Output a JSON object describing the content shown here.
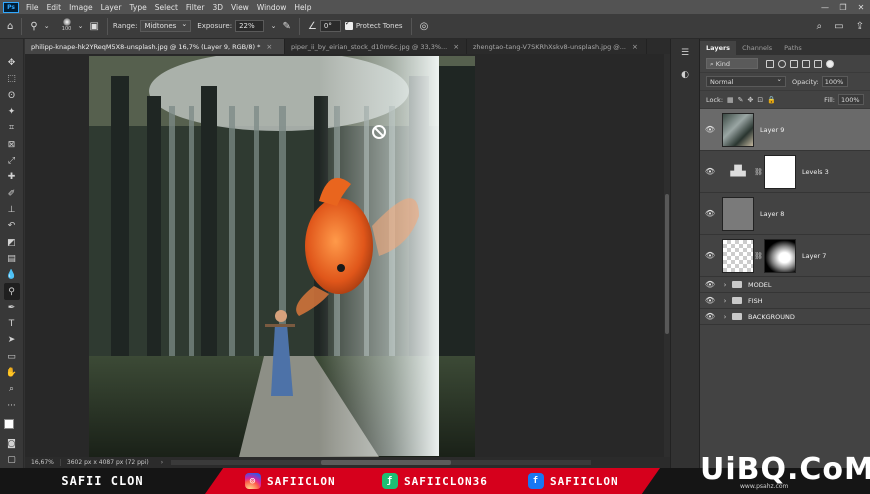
{
  "menubar": {
    "logo": "Ps",
    "items": [
      "File",
      "Edit",
      "Image",
      "Layer",
      "Type",
      "Select",
      "Filter",
      "3D",
      "View",
      "Window",
      "Help"
    ],
    "controls": [
      "—",
      "❐",
      "✕"
    ]
  },
  "options": {
    "brush_size": "100",
    "range_label": "Range:",
    "range_value": "Midtones",
    "exposure_label": "Exposure:",
    "exposure_value": "22%",
    "angle_value": "0°",
    "protect_tones": "Protect Tones"
  },
  "tabs": [
    {
      "label": "philipp-knape-hk2YReqM5X8-unsplash.jpg @ 16,7% (Layer 9, RGB/8) *",
      "close": "×"
    },
    {
      "label": "piper_ii_by_eirian_stock_d10m6c.jpg @ 33,3%...",
      "close": "×"
    },
    {
      "label": "zhengtao-tang-V7SKRhXskv8-unsplash.jpg @...",
      "close": "×"
    }
  ],
  "status": {
    "zoom": "16,67%",
    "doc_size": "3602 px x 4087 px (72 ppi)",
    "arrow": "›"
  },
  "layers_panel": {
    "tabs": [
      "Layers",
      "Channels",
      "Paths"
    ],
    "kind_label": "Kind",
    "blend_mode": "Normal",
    "opacity_label": "Opacity:",
    "opacity_value": "100%",
    "lock_label": "Lock:",
    "fill_label": "Fill:",
    "fill_value": "100%",
    "layers": [
      {
        "name": "Layer 9"
      },
      {
        "name": "Levels 3"
      },
      {
        "name": "Layer 8"
      },
      {
        "name": "Layer 7"
      }
    ],
    "groups": [
      {
        "name": "MODEL"
      },
      {
        "name": "FISH"
      },
      {
        "name": "BACKGROUND"
      }
    ]
  },
  "banner": {
    "name": "SAFII CLON",
    "instagram": "SAFIICLON",
    "fiverr": "SAFIICLON36",
    "facebook": "SAFIICLON",
    "watermark": "UiBQ.CoM",
    "watermark_sub": "www.psahz.com"
  }
}
